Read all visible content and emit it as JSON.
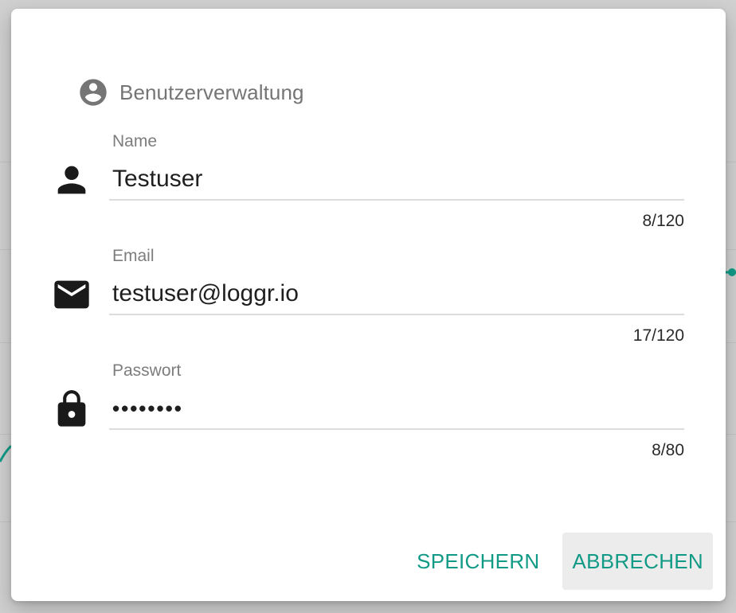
{
  "dialog": {
    "title": "Benutzerverwaltung",
    "fields": [
      {
        "label": "Name",
        "value": "Testuser",
        "counter": "8/120",
        "icon": "person-icon"
      },
      {
        "label": "Email",
        "value": "testuser@loggr.io",
        "counter": "17/120",
        "icon": "mail-icon"
      },
      {
        "label": "Passwort",
        "value": "••••••••",
        "counter": "8/80",
        "icon": "lock-icon"
      }
    ],
    "actions": {
      "save_label": "SPEICHERN",
      "cancel_label": "ABBRECHEN"
    }
  },
  "colors": {
    "accent": "#119a86",
    "label": "#7d7d7d",
    "text": "#1f1f1f",
    "icon_header": "#757575",
    "icon_field": "#1a1a1a",
    "cancel_bg": "#ececec"
  }
}
